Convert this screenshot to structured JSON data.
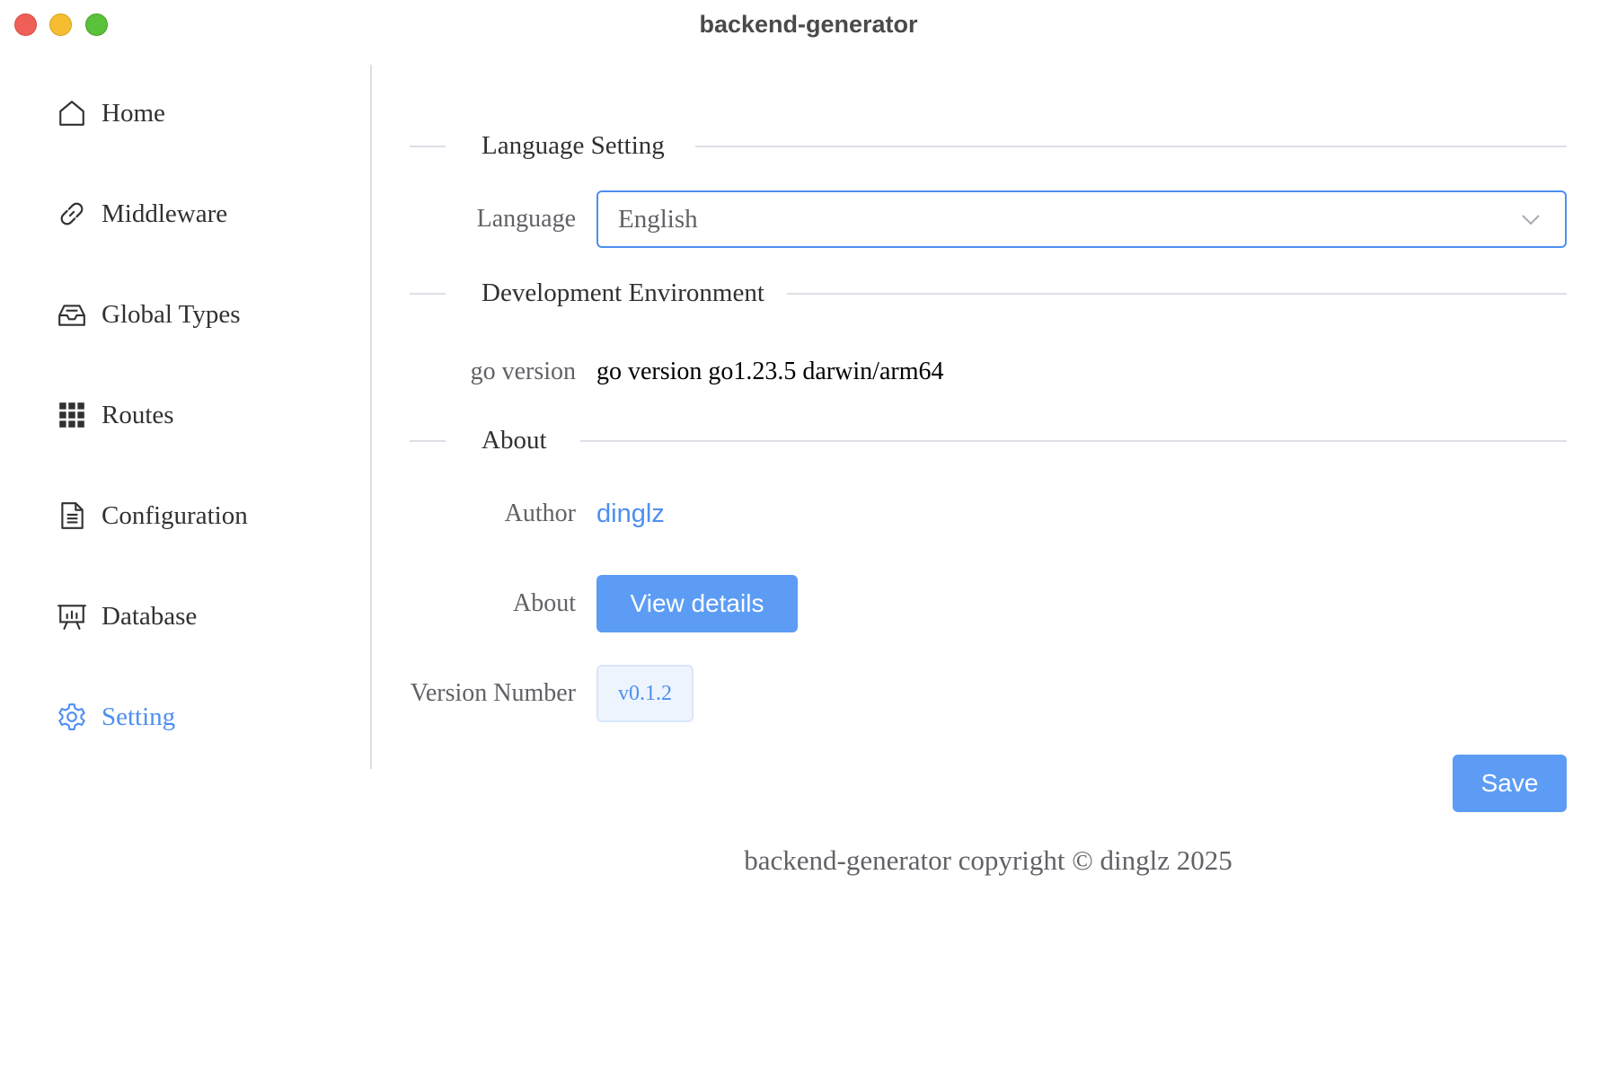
{
  "window": {
    "title": "backend-generator"
  },
  "sidebar": {
    "items": [
      {
        "label": "Home",
        "icon": "home-icon"
      },
      {
        "label": "Middleware",
        "icon": "link-icon"
      },
      {
        "label": "Global Types",
        "icon": "inbox-icon"
      },
      {
        "label": "Routes",
        "icon": "grid-icon"
      },
      {
        "label": "Configuration",
        "icon": "document-icon"
      },
      {
        "label": "Database",
        "icon": "presentation-icon"
      },
      {
        "label": "Setting",
        "icon": "gear-icon"
      }
    ],
    "active_item": "Setting"
  },
  "settings": {
    "language_section": {
      "title": "Language Setting",
      "language_label": "Language",
      "language_value": "English"
    },
    "environment_section": {
      "title": "Development Environment",
      "go_label": "go version",
      "go_value": "go version go1.23.5 darwin/arm64"
    },
    "about_section": {
      "title": "About",
      "author_label": "Author",
      "author_value": "dinglz",
      "about_label": "About",
      "view_details_label": "View details",
      "version_label": "Version Number",
      "version_value": "v0.1.2"
    },
    "save_label": "Save"
  },
  "footer": {
    "text": "backend-generator copyright © dinglz 2025"
  },
  "colors": {
    "accent": "#4d8ff0",
    "button": "#5c9cf5",
    "divider": "#dcdfe6"
  }
}
